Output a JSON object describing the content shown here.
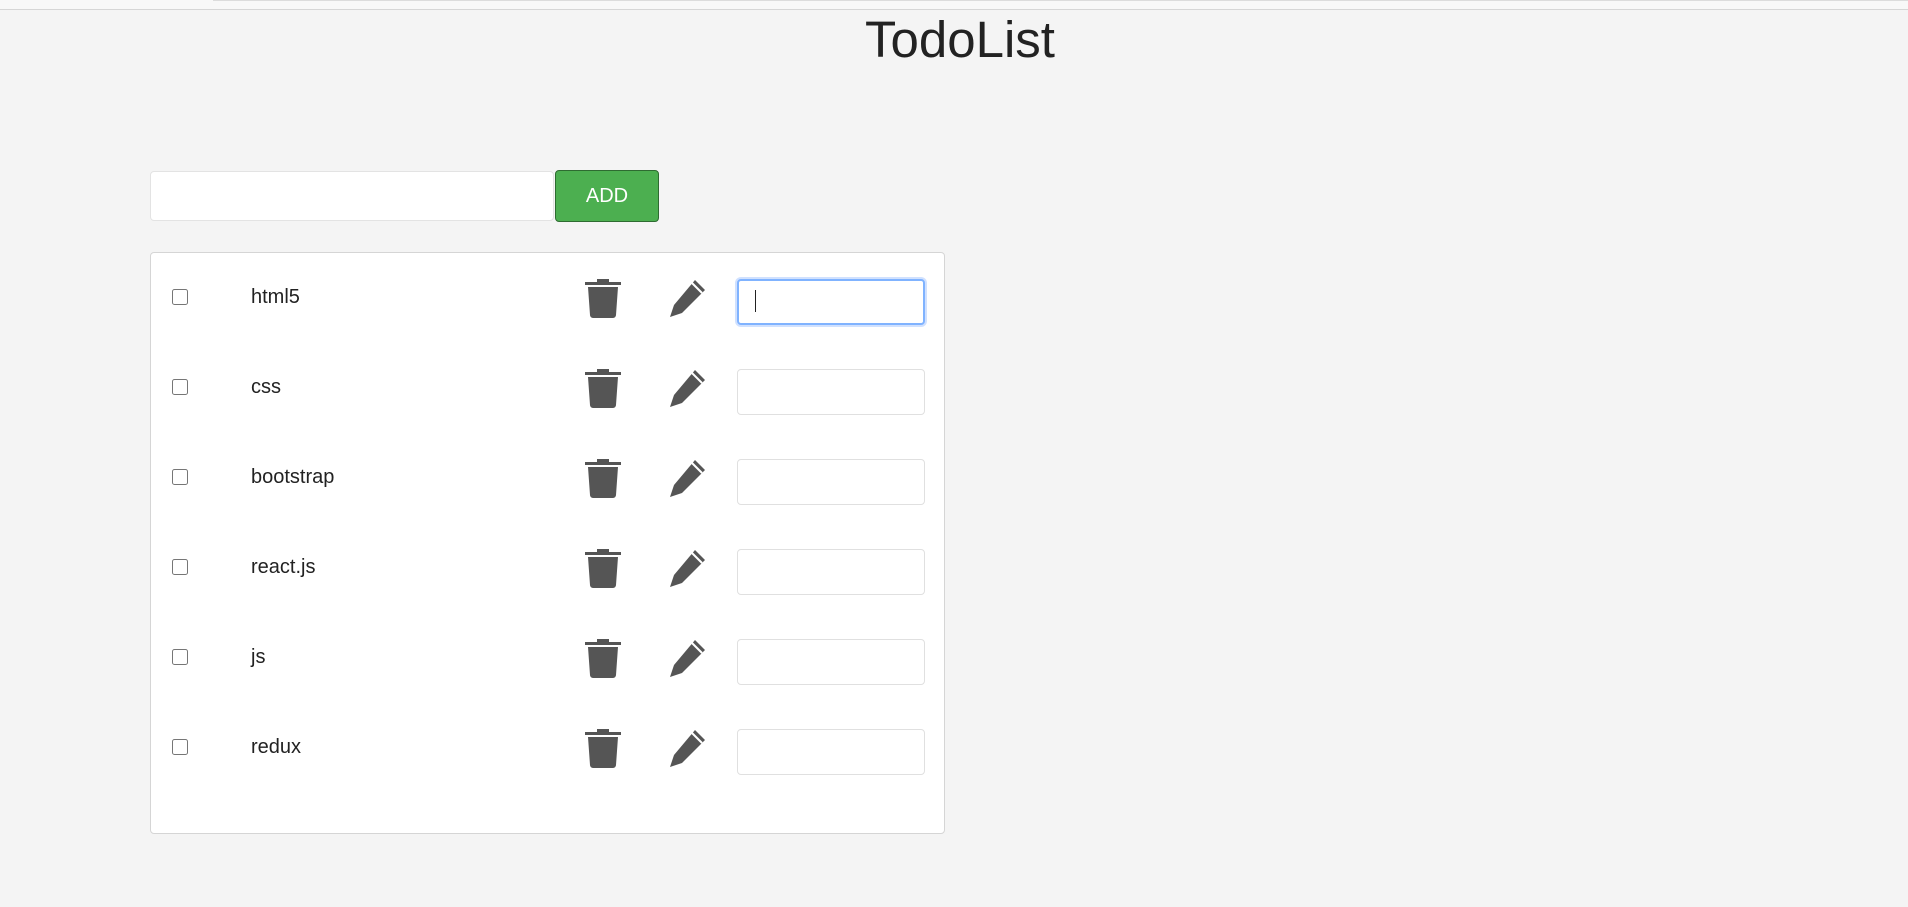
{
  "app": {
    "title": "TodoList"
  },
  "add_form": {
    "input_value": "",
    "button_label": "ADD",
    "accent_color": "#4caf50"
  },
  "todos": [
    {
      "text": "html5",
      "done": false,
      "edit_value": "",
      "focused": true
    },
    {
      "text": "css",
      "done": false,
      "edit_value": "",
      "focused": false
    },
    {
      "text": "bootstrap",
      "done": false,
      "edit_value": "",
      "focused": false
    },
    {
      "text": "react.js",
      "done": false,
      "edit_value": "",
      "focused": false
    },
    {
      "text": "js",
      "done": false,
      "edit_value": "",
      "focused": false
    },
    {
      "text": "redux",
      "done": false,
      "edit_value": "",
      "focused": false
    }
  ],
  "icons": {
    "delete": "trash-icon",
    "edit": "pencil-icon",
    "icon_color": "#555555"
  }
}
